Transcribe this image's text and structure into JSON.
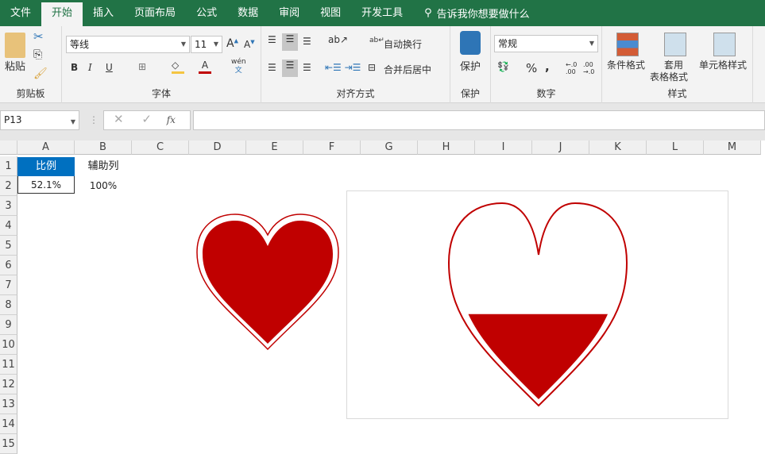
{
  "tabs": [
    "文件",
    "开始",
    "插入",
    "页面布局",
    "公式",
    "数据",
    "审阅",
    "视图",
    "开发工具"
  ],
  "tell_me": "告诉我你想要做什么",
  "ribbon": {
    "clipboard": {
      "paste": "粘贴",
      "label": "剪贴板"
    },
    "font": {
      "name": "等线",
      "size": "11",
      "label": "字体",
      "bold": "B",
      "italic": "I",
      "underline": "U",
      "phonetic": "wén"
    },
    "align": {
      "wrap": "自动换行",
      "merge": "合并后居中",
      "label": "对齐方式"
    },
    "protect": {
      "button": "保护",
      "label": "保护"
    },
    "number": {
      "format": "常规",
      "percent": "%",
      "comma": ",",
      "label": "数字"
    },
    "styles": {
      "conditional": "条件格式",
      "table_line1": "套用",
      "table_line2": "表格格式",
      "cell": "单元格样式",
      "label": "样式"
    }
  },
  "formula_bar": {
    "name_box": "P13",
    "fx": "fx",
    "value": ""
  },
  "columns": [
    "A",
    "B",
    "C",
    "D",
    "E",
    "F",
    "G",
    "H",
    "I",
    "J",
    "K",
    "L",
    "M"
  ],
  "rows": [
    "1",
    "2",
    "3",
    "4",
    "5",
    "6",
    "7",
    "8",
    "9",
    "10",
    "11",
    "12",
    "13",
    "14",
    "15"
  ],
  "cells": {
    "A1": "比例",
    "B1": "辅助列",
    "A2": "52.1%",
    "B2": "100%"
  },
  "chart": {
    "fill_fraction": 0.521,
    "color": "#c00000"
  },
  "colors": {
    "accent": "#217346",
    "header_fill": "#0070c0",
    "heart": "#c00000"
  }
}
